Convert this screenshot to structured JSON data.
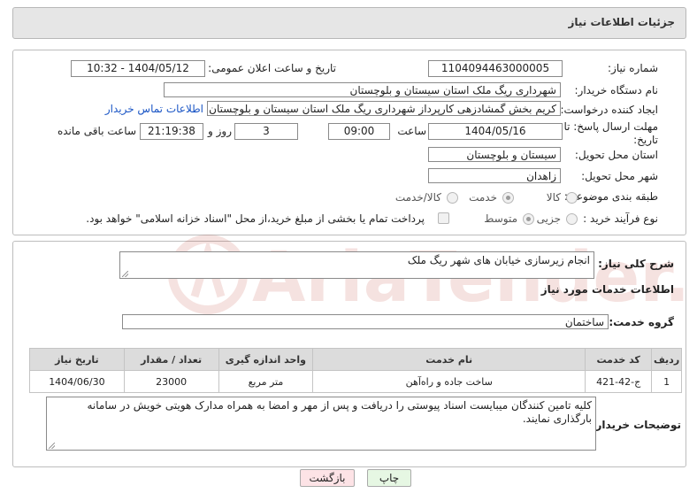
{
  "header": {
    "title": "جزئیات اطلاعات نیاز"
  },
  "form": {
    "need_number_label": "شماره نیاز:",
    "need_number": "1104094463000005",
    "announce_label": "تاریخ و ساعت اعلان عمومی:",
    "announce_value": "1404/05/12 - 10:32",
    "buyer_org_label": "نام دستگاه خریدار:",
    "buyer_org": "شهرداری ریگ ملک استان سیستان و بلوچستان",
    "creator_label": "ایجاد کننده درخواست:",
    "creator": "کریم بخش گمشادزهی کارپرداز شهرداری ریگ ملک استان سیستان و بلوچستان",
    "buyer_contact_link": "اطلاعات تماس خریدار",
    "deadline_label_1": "مهلت ارسال پاسخ: تا",
    "deadline_label_2": "تاریخ:",
    "deadline_date": "1404/05/16",
    "time_label": "ساعت",
    "deadline_time": "09:00",
    "days_value": "3",
    "days_label": "روز و",
    "remaining_time": "21:19:38",
    "remaining_label": "ساعت باقی مانده",
    "province_label": "استان محل تحویل:",
    "province": "سیستان و بلوچستان",
    "city_label": "شهر محل تحویل:",
    "city": "زاهدان",
    "category_label": "طبقه بندی موضوعی:",
    "category_options": [
      "کالا",
      "خدمت",
      "کالا/خدمت"
    ],
    "category_selected": "خدمت",
    "purchase_type_label": "نوع فرآیند خرید :",
    "purchase_options": [
      "جزیی",
      "متوسط"
    ],
    "purchase_selected": "متوسط",
    "payment_note": "پرداخت تمام یا بخشی از مبلغ خرید،از محل \"اسناد خزانه اسلامی\" خواهد بود."
  },
  "details": {
    "summary_label": "شرح کلی نیاز:",
    "summary": "انجام زیرسازی خیابان های شهر ریگ ملک",
    "services_title": "اطلاعات خدمات مورد نیاز",
    "service_group_label": "گروه خدمت:",
    "service_group": "ساختمان",
    "table": {
      "headers": [
        "ردیف",
        "کد خدمت",
        "نام خدمت",
        "واحد اندازه گیری",
        "تعداد / مقدار",
        "تاریخ نیاز"
      ],
      "rows": [
        [
          "1",
          "ج-42-421",
          "ساخت جاده و راه‌آهن",
          "متر مربع",
          "23000",
          "1404/06/30"
        ]
      ]
    },
    "buyer_notes_label": "توضیحات خریدار:",
    "buyer_notes": "کلیه تامین کنندگان میبایست اسناد پیوستی را دریافت و پس از مهر و امضا به همراه مدارک هویتی خویش در سامانه بارگذاری نمایند."
  },
  "buttons": {
    "print": "چاپ",
    "back": "بازگشت"
  },
  "watermark_text": "AriaTender.neT",
  "colors": {
    "link": "#1a55c5",
    "back_button_bg": "#fde3e6",
    "print_button_bg": "#e6f7e3",
    "watermark": "#c0392b"
  }
}
